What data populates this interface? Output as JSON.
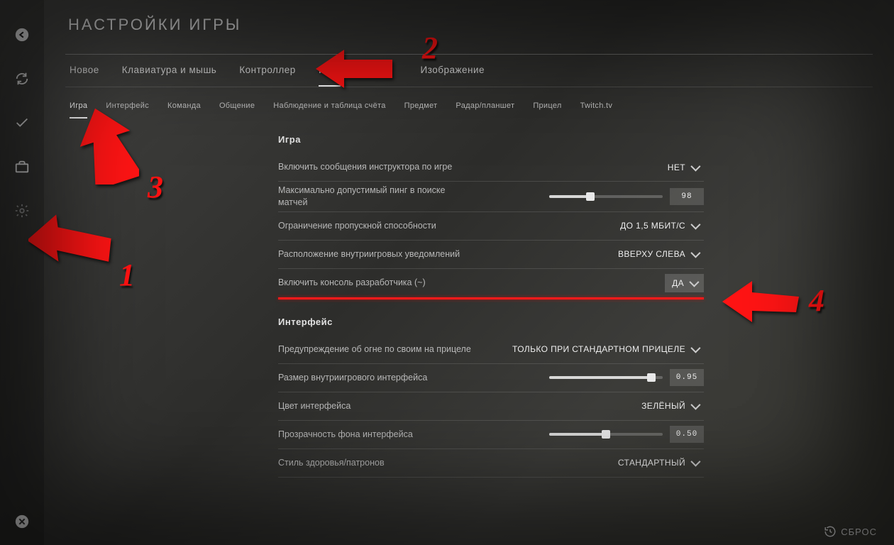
{
  "title": "НАСТРОЙКИ ИГРЫ",
  "tabs": [
    "Новое",
    "Клавиатура и мышь",
    "Контроллер",
    "Игра",
    "Изображение"
  ],
  "active_tab_index": 3,
  "subtabs": [
    "Игра",
    "Интерфейс",
    "Команда",
    "Общение",
    "Наблюдение и таблица счёта",
    "Предмет",
    "Радар/планшет",
    "Прицел",
    "Twitch.tv"
  ],
  "active_subtab_index": 0,
  "sections": {
    "game": {
      "header": "Игра",
      "rows": {
        "instructor": {
          "label": "Включить сообщения инструктора по игре",
          "value": "НЕТ"
        },
        "ping": {
          "label": "Максимально допустимый пинг в поиске матчей",
          "value": "98",
          "slider_pct": 36
        },
        "bandwidth": {
          "label": "Ограничение пропускной способности",
          "value": "ДО 1,5 МБИТ/С"
        },
        "notif_pos": {
          "label": "Расположение внутриигровых уведомлений",
          "value": "ВВЕРХУ СЛЕВА"
        },
        "console": {
          "label": "Включить консоль разработчика (~)",
          "value": "ДА"
        }
      }
    },
    "hud": {
      "header": "Интерфейс",
      "rows": {
        "ff_warn": {
          "label": "Предупреждение об огне по своим на прицеле",
          "value": "ТОЛЬКО ПРИ СТАНДАРТНОМ ПРИЦЕЛЕ"
        },
        "hud_scale": {
          "label": "Размер внутриигрового интерфейса",
          "value": "0.95",
          "slider_pct": 90
        },
        "hud_color": {
          "label": "Цвет интерфейса",
          "value": "ЗЕЛЁНЫЙ"
        },
        "hud_alpha": {
          "label": "Прозрачность фона интерфейса",
          "value": "0.50",
          "slider_pct": 50
        },
        "health_style": {
          "label": "Стиль здоровья/патронов",
          "value": "СТАНДАРТНЫЙ"
        }
      }
    }
  },
  "reset_label": "СБРОС",
  "annotation_numbers": {
    "n1": "1",
    "n2": "2",
    "n3": "3",
    "n4": "4"
  }
}
